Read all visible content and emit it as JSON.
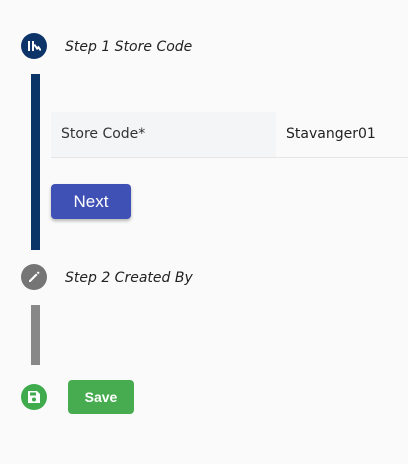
{
  "steps": [
    {
      "title": "Step 1 Store Code",
      "icon": "sliders-icon",
      "color": "#0d3469"
    },
    {
      "title": "Step 2 Created By",
      "icon": "pencil-icon",
      "color": "#757575"
    }
  ],
  "form": {
    "store_code_label": "Store Code*",
    "store_code_value": "Stavanger01"
  },
  "buttons": {
    "next_label": "Next",
    "save_label": "Save"
  },
  "colors": {
    "primary_dark": "#0d3469",
    "primary_button": "#3f51b5",
    "inactive": "#757575",
    "success": "#47ac4f"
  }
}
